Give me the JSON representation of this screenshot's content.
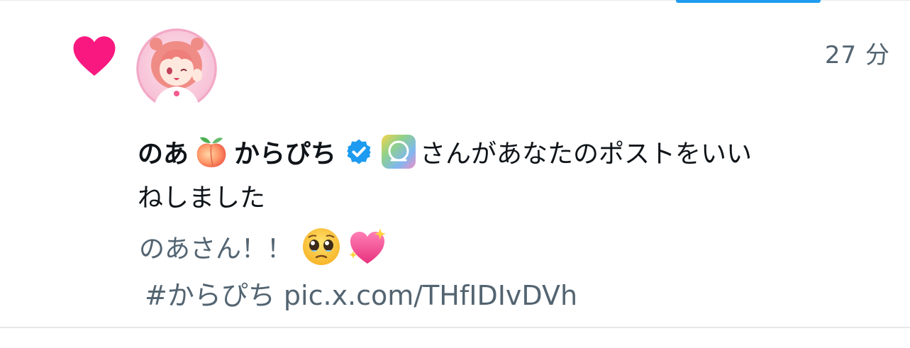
{
  "notification": {
    "type_icon": "heart-icon",
    "time": "27 分",
    "user": {
      "name_part1": "のあ",
      "name_emoji": "peach-emoji",
      "name_part2": "からぴち",
      "verified": "verified-badge-icon",
      "app_icon": "app-icon"
    },
    "action_line1": "さんがあなたのポストをいい",
    "action_line2": "ねしました",
    "post": {
      "text": "のあさん！！",
      "emojis": [
        "pleading-face-emoji",
        "sparkling-heart-emoji"
      ],
      "hashtag_and_link": "#からぴち pic.x.com/THfIDIvDVh"
    }
  },
  "colors": {
    "heart": "#f91880",
    "accent": "#1d9bf0",
    "secondary_text": "#536471",
    "primary_text": "#0f1419",
    "divider": "#e6e8ea"
  }
}
